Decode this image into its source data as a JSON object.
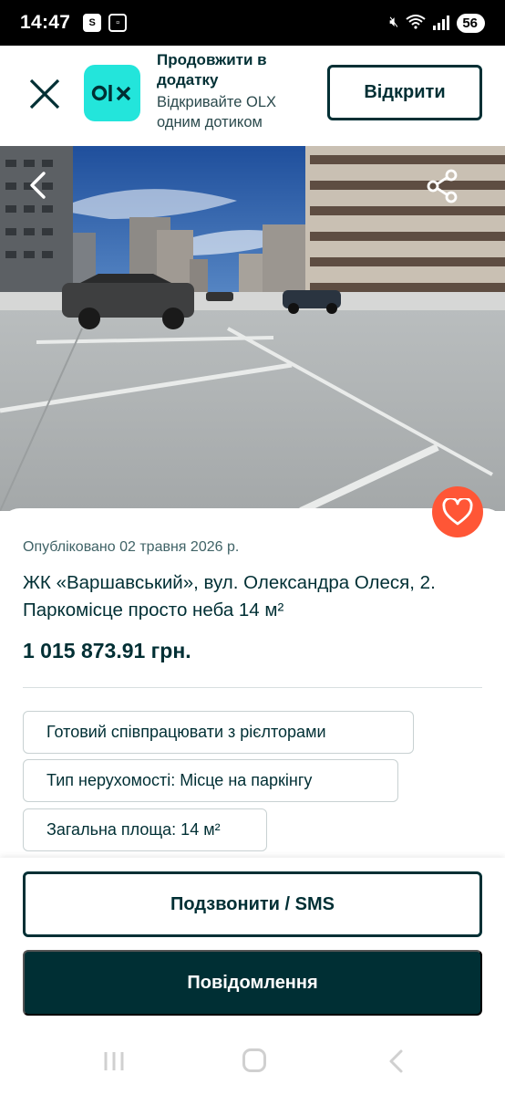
{
  "status_bar": {
    "time": "14:47",
    "left_icons": [
      "s-app-icon",
      "screenshot-icon"
    ],
    "battery": "56",
    "right_icons": [
      "mute-icon",
      "wifi-icon",
      "signal-icon",
      "battery-icon"
    ]
  },
  "app_banner": {
    "title": "Продовжити в додатку",
    "subtitle": "Відкривайте OLX одним дотиком",
    "logo_text": "OLX",
    "open_label": "Відкрити",
    "accent": "#23e5db"
  },
  "listing": {
    "published": "Опубліковано 02 травня 2026 р.",
    "title": "ЖК «Варшавський», вул. Олександра Олеся, 2. Паркомісце просто неба 14 м²",
    "price": "1 015 873.91 грн.",
    "tags": [
      "Готовий співпрацювати з рієлторами",
      "Тип нерухомості: Місце на паркінгу",
      "Загальна площа: 14 м²"
    ]
  },
  "actions": {
    "call_label": "Подзвонити / SMS",
    "message_label": "Повідомлення"
  },
  "colors": {
    "primary": "#002f34",
    "favorite": "#ff5636",
    "olx_teal": "#23e5db"
  }
}
